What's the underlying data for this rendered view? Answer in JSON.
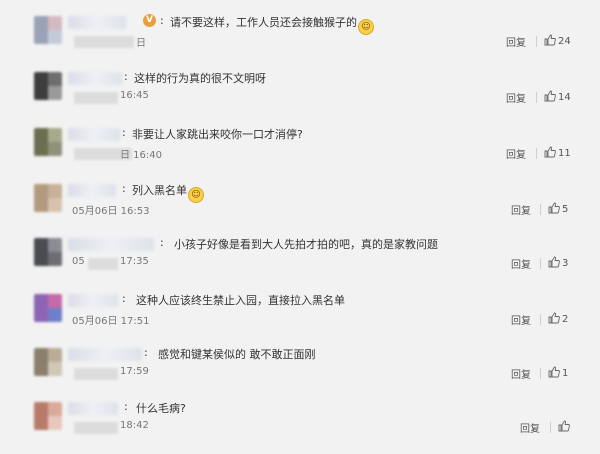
{
  "comments": [
    {
      "user_suffix": "",
      "text": "请不要这样，工作人员还会接触猴子的",
      "has_vip": true,
      "emoji": true,
      "date_prefix": "",
      "time": "日",
      "reply": "回复",
      "likes": "24",
      "colors": [
        "#9aa3b5",
        "#d3b9c0",
        "#c4cbd8"
      ]
    },
    {
      "user_suffix": "",
      "text": "这样的行为真的很不文明呀",
      "has_vip": false,
      "emoji": false,
      "date_prefix": "",
      "time": "16:45",
      "reply": "回复",
      "likes": "14",
      "colors": [
        "#3d3d3d",
        "#6e6e6e",
        "#9a9a9a"
      ]
    },
    {
      "user_suffix": "",
      "text": "非要让人家跳出来咬你一口才消停?",
      "has_vip": false,
      "emoji": false,
      "date_prefix": "",
      "time": "日 16:40",
      "reply": "回复",
      "likes": "11",
      "colors": [
        "#6b6f4f",
        "#a7aa8b",
        "#8f9279"
      ]
    },
    {
      "user_suffix": "",
      "text": "列入黑名单",
      "has_vip": false,
      "emoji": true,
      "date_prefix": "05月06日",
      "time": "16:53",
      "reply": "回复",
      "likes": "5",
      "colors": [
        "#b29a7f",
        "#c8b09a",
        "#d7c3ad"
      ]
    },
    {
      "user_suffix": "",
      "text": "小孩子好像是看到大人先拍才拍的吧，真的是家教问题",
      "has_vip": false,
      "emoji": false,
      "date_prefix": "05",
      "time": "17:35",
      "reply": "回复",
      "likes": "3",
      "colors": [
        "#4b4b52",
        "#8c8c94",
        "#6d6d73"
      ]
    },
    {
      "user_suffix": "",
      "text": "这种人应该终生禁止入园，直接拉入黑名单",
      "has_vip": false,
      "emoji": false,
      "date_prefix": "05月06日",
      "time": "17:51",
      "reply": "回复",
      "likes": "2",
      "colors": [
        "#8c64b4",
        "#c46aa8",
        "#6f7fc9"
      ]
    },
    {
      "user_suffix": "",
      "text": "感觉和键某侯似的 敢不敢正面刚",
      "has_vip": false,
      "emoji": false,
      "date_prefix": "",
      "time": "17:59",
      "reply": "回复",
      "likes": "1",
      "colors": [
        "#8a7f6c",
        "#b9ad98",
        "#d0c7b6"
      ]
    },
    {
      "user_suffix": "",
      "text": "什么毛病?",
      "has_vip": false,
      "emoji": false,
      "date_prefix": "",
      "time": "18:42",
      "reply": "回复",
      "likes": "",
      "colors": [
        "#b87b6a",
        "#d9aa9a",
        "#e8c8bd"
      ]
    }
  ]
}
